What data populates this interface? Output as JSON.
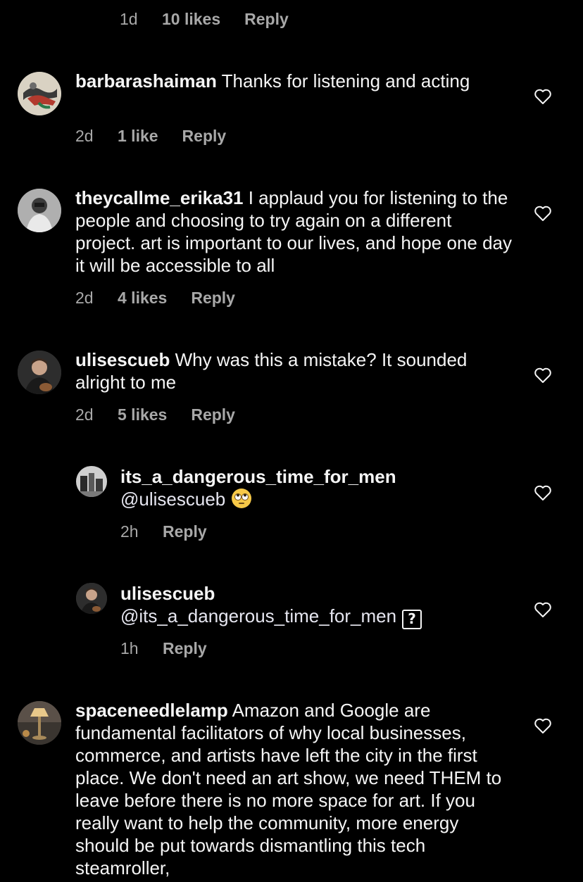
{
  "top_meta": {
    "time": "1d",
    "likes": "10 likes",
    "reply": "Reply"
  },
  "comments": [
    {
      "username": "barbarashaiman",
      "body": " Thanks for listening and acting",
      "time": "2d",
      "likes": "1 like",
      "reply": "Reply"
    },
    {
      "username": "theycallme_erika31",
      "body": " I applaud you for listening to the people and choosing to try again on a different project. art is important to our lives, and hope one day it will be accessible to all",
      "time": "2d",
      "likes": "4 likes",
      "reply": "Reply"
    },
    {
      "username": "ulisescueb",
      "body": " Why was this a mistake? It sounded alright to me",
      "time": "2d",
      "likes": "5 likes",
      "reply": "Reply"
    },
    {
      "username": "its_a_dangerous_time_for_men",
      "mention": "@ulisescueb",
      "emoji": "face-with-rolling-eyes-emoji",
      "time": "2h",
      "reply": "Reply"
    },
    {
      "username": "ulisescueb",
      "mention": "@its_a_dangerous_time_for_men",
      "emoji": "unknown-glyph-box",
      "emoji_char": "?",
      "time": "1h",
      "reply": "Reply"
    },
    {
      "username": "spaceneedlelamp",
      "body": " Amazon and Google are fundamental facilitators of why local businesses, commerce, and artists have left the city in the first place. We don't need an art show, we need THEM to leave before there is no more space for art.  If you really want to help the community, more energy should be put towards dismantling this tech steamroller,"
    }
  ],
  "icons": {
    "like": "heart-outline-icon"
  },
  "colors": {
    "background": "#000000",
    "text": "#f5f5f5",
    "meta": "#a8a8a8"
  }
}
